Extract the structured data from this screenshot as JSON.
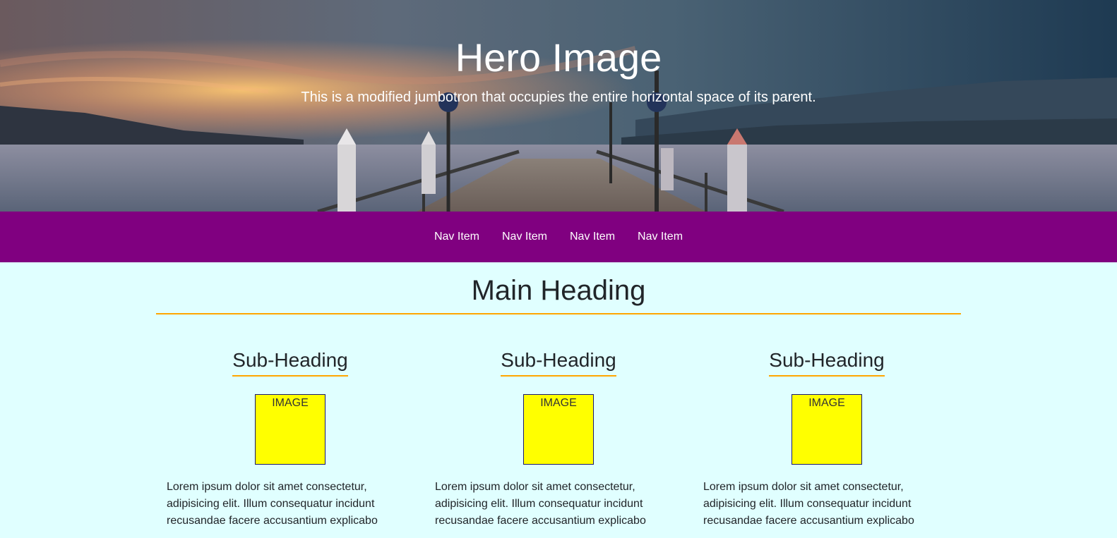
{
  "hero": {
    "title": "Hero Image",
    "subtitle": "This is a modified jumbotron that occupies the entire horizontal space of its parent."
  },
  "nav": {
    "items": [
      {
        "label": "Nav Item"
      },
      {
        "label": "Nav Item"
      },
      {
        "label": "Nav Item"
      },
      {
        "label": "Nav Item"
      }
    ]
  },
  "main": {
    "heading": "Main Heading",
    "columns": [
      {
        "sub_heading": "Sub-Heading",
        "image_label": "IMAGE",
        "text": "Lorem ipsum dolor sit amet consectetur, adipisicing elit. Illum consequatur incidunt recusandae facere accusantium explicabo"
      },
      {
        "sub_heading": "Sub-Heading",
        "image_label": "IMAGE",
        "text": "Lorem ipsum dolor sit amet consectetur, adipisicing elit. Illum consequatur incidunt recusandae facere accusantium explicabo"
      },
      {
        "sub_heading": "Sub-Heading",
        "image_label": "IMAGE",
        "text": "Lorem ipsum dolor sit amet consectetur, adipisicing elit. Illum consequatur incidunt recusandae facere accusantium explicabo"
      }
    ]
  },
  "colors": {
    "nav_background": "#800080",
    "page_background": "#e0ffff",
    "accent_rule": "#ffa500",
    "image_placeholder": "#ffff00"
  }
}
